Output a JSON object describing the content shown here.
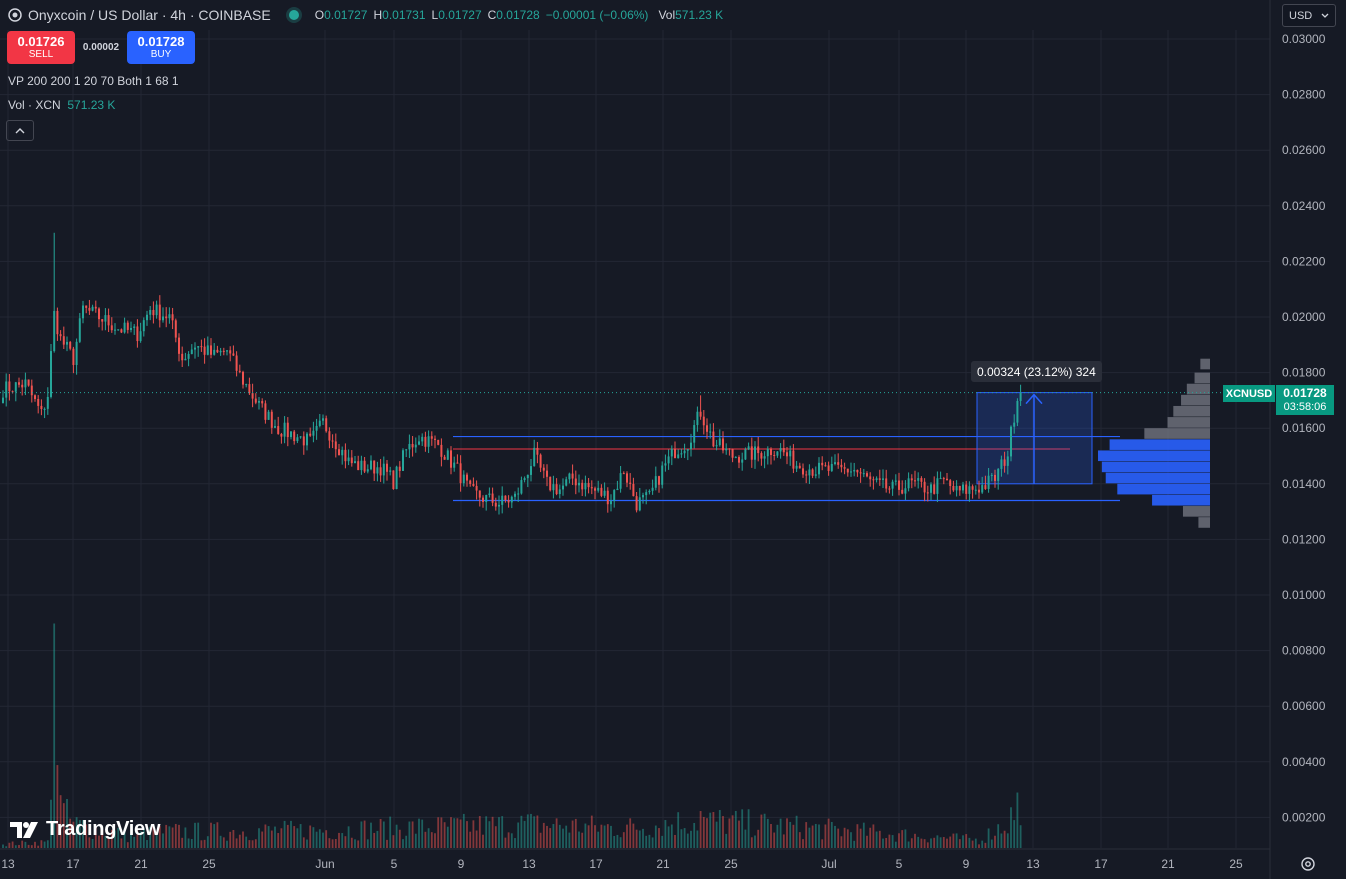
{
  "header": {
    "symbol_title": "Onyxcoin / US Dollar · 4h · COINBASE",
    "ohlc": {
      "o_label": "O",
      "o_value": "0.01727",
      "h_label": "H",
      "h_value": "0.01731",
      "l_label": "L",
      "l_value": "0.01727",
      "c_label": "C",
      "c_value": "0.01728",
      "change": "−0.00001 (−0.06%)",
      "vol_label": "Vol",
      "vol_value": "571.23 K"
    },
    "currency": "USD"
  },
  "trade": {
    "sell_price": "0.01726",
    "sell_label": "SELL",
    "spread": "0.00002",
    "buy_price": "0.01728",
    "buy_label": "BUY"
  },
  "indicators": {
    "vp": "VP 200 200 1 20 70 Both 1 68 1",
    "vol_label": "Vol · XCN",
    "vol_value": "571.23 K"
  },
  "branding": {
    "logo_text": "TradingView"
  },
  "price_label": {
    "symbol": "XCNUSD",
    "price": "0.01728",
    "countdown": "03:58:06"
  },
  "measure_label": "0.00324 (23.12%) 324",
  "colors": {
    "up": "#26a69a",
    "down": "#ef5350",
    "accent": "#2962ff",
    "background": "#161a25"
  },
  "icons": [
    "tradingview-logo-icon",
    "market-status-icon",
    "chevron-up-icon",
    "chevron-down-icon",
    "settings-icon"
  ],
  "chart_data": {
    "type": "candlestick",
    "interval": "4h",
    "y_axis": {
      "ticks": [
        "0.03000",
        "0.02800",
        "0.02600",
        "0.02400",
        "0.02200",
        "0.02000",
        "0.01800",
        "0.01600",
        "0.01400",
        "0.01200",
        "0.01000",
        "0.00800",
        "0.00600",
        "0.00400",
        "0.00200"
      ],
      "range": [
        0.0009,
        0.0303
      ],
      "side": "right"
    },
    "x_axis": {
      "ticks": [
        "13",
        "17",
        "21",
        "25",
        "Jun",
        "5",
        "9",
        "13",
        "17",
        "21",
        "25",
        "Jul",
        "5",
        "9",
        "13",
        "17",
        "21",
        "25"
      ]
    },
    "price_path": [
      [
        0,
        0.0174
      ],
      [
        7,
        0.0176
      ],
      [
        12,
        0.0165
      ],
      [
        14,
        0.0172
      ],
      [
        16,
        0.0201
      ],
      [
        18,
        0.0192
      ],
      [
        22,
        0.0185
      ],
      [
        25,
        0.0203
      ],
      [
        30,
        0.02
      ],
      [
        36,
        0.0196
      ],
      [
        42,
        0.0194
      ],
      [
        46,
        0.0203
      ],
      [
        52,
        0.02
      ],
      [
        56,
        0.0185
      ],
      [
        60,
        0.019
      ],
      [
        66,
        0.0186
      ],
      [
        70,
        0.0188
      ],
      [
        74,
        0.0179
      ],
      [
        80,
        0.0168
      ],
      [
        86,
        0.016
      ],
      [
        90,
        0.0158
      ],
      [
        96,
        0.0155
      ],
      [
        100,
        0.0162
      ],
      [
        104,
        0.0155
      ],
      [
        108,
        0.0148
      ],
      [
        112,
        0.0146
      ],
      [
        118,
        0.0146
      ],
      [
        122,
        0.0141
      ],
      [
        126,
        0.0152
      ],
      [
        130,
        0.0157
      ],
      [
        136,
        0.0154
      ],
      [
        142,
        0.0145
      ],
      [
        146,
        0.0137
      ],
      [
        150,
        0.0135
      ],
      [
        155,
        0.0133
      ],
      [
        160,
        0.0135
      ],
      [
        166,
        0.015
      ],
      [
        170,
        0.014
      ],
      [
        174,
        0.0138
      ],
      [
        178,
        0.0142
      ],
      [
        184,
        0.0138
      ],
      [
        190,
        0.0135
      ],
      [
        194,
        0.0145
      ],
      [
        198,
        0.0133
      ],
      [
        202,
        0.0135
      ],
      [
        206,
        0.0145
      ],
      [
        210,
        0.0152
      ],
      [
        214,
        0.0155
      ],
      [
        218,
        0.0166
      ],
      [
        222,
        0.0155
      ],
      [
        228,
        0.015
      ],
      [
        236,
        0.0151
      ],
      [
        242,
        0.0153
      ],
      [
        248,
        0.0147
      ],
      [
        254,
        0.0145
      ],
      [
        260,
        0.0145
      ],
      [
        266,
        0.0145
      ],
      [
        272,
        0.014
      ],
      [
        278,
        0.0138
      ],
      [
        284,
        0.014
      ],
      [
        290,
        0.0138
      ],
      [
        294,
        0.0141
      ],
      [
        298,
        0.0137
      ],
      [
        302,
        0.0138
      ],
      [
        306,
        0.0139
      ],
      [
        310,
        0.0142
      ],
      [
        314,
        0.0151
      ],
      [
        317,
        0.0172
      ],
      [
        318,
        0.01728
      ]
    ],
    "volume_path": [
      [
        0,
        0.0002
      ],
      [
        14,
        0.0003
      ],
      [
        16,
        0.0085
      ],
      [
        18,
        0.002
      ],
      [
        22,
        0.0012
      ],
      [
        40,
        0.0006
      ],
      [
        46,
        0.0008
      ],
      [
        100,
        0.0009
      ],
      [
        166,
        0.0012
      ],
      [
        194,
        0.001
      ],
      [
        218,
        0.0014
      ],
      [
        305,
        0.0004
      ],
      [
        314,
        0.0013
      ],
      [
        317,
        0.0021
      ],
      [
        318,
        0.001
      ]
    ],
    "range_box": {
      "top": 0.0157,
      "bottom": 0.0134,
      "midline": 0.01525
    },
    "measure": {
      "from": 0.014,
      "to": 0.01728,
      "change": 0.00324,
      "percent": 23.12
    },
    "volume_profile": {
      "bins": [
        0.0183,
        0.0178,
        0.0174,
        0.017,
        0.0166,
        0.0162,
        0.0158,
        0.0154,
        0.015,
        0.0146,
        0.0142,
        0.0138,
        0.0134,
        0.013,
        0.0126
      ],
      "values": [
        0.05,
        0.08,
        0.12,
        0.15,
        0.19,
        0.22,
        0.34,
        0.52,
        0.58,
        0.56,
        0.54,
        0.48,
        0.3,
        0.14,
        0.06
      ],
      "value_area": [
        0.0134,
        0.0157
      ]
    }
  }
}
